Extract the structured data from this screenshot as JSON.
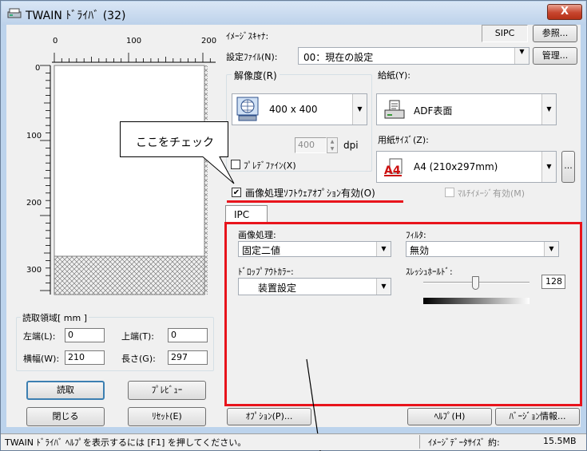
{
  "window": {
    "title": "TWAIN ﾄﾞﾗｲﾊﾞ (32)",
    "close_label": "X"
  },
  "ruler": {
    "top_ticks": [
      "0",
      "100",
      "200"
    ],
    "left_ticks": [
      "0",
      "100",
      "200",
      "300"
    ]
  },
  "scanner": {
    "label": "ｲﾒｰｼﾞｽｷｬﾅ:",
    "name": "SIPC",
    "browse": "参照..."
  },
  "settings_file": {
    "label": "設定ﾌｧｲﾙ(N):",
    "value": "00：現在の設定",
    "manage": "管理..."
  },
  "resolution": {
    "label": "解像度(R)",
    "value": "400 x 400",
    "spin_value": "400",
    "unit": "dpi",
    "preset_label": "ﾌﾟﾚﾃﾞﾌｧｲﾝ(X)"
  },
  "feed": {
    "label": "給紙(Y):",
    "value": "ADF表面"
  },
  "paper_size": {
    "label": "用紙ｻｲｽﾞ(Z):",
    "value": "A4 (210x297mm)",
    "icon_text": "A4",
    "more": "..."
  },
  "callout": {
    "text": "ここをチェック"
  },
  "ipc_option": {
    "label": "画像処理ｿﾌﾄｳｪｱｵﾌﾟｼｮﾝ有効(O)",
    "checked": true
  },
  "multi_image": {
    "label": "ﾏﾙﾁｲﾒｰｼﾞ有効(M)"
  },
  "ipc_tab": {
    "label": "IPC",
    "image_processing_label": "画像処理:",
    "image_processing_value": "固定二値",
    "filter_label": "ﾌｨﾙﾀ:",
    "filter_value": "無効",
    "dropout_label": "ﾄﾞﾛｯﾌﾟｱｳﾄｶﾗｰ:",
    "dropout_value": "装置設定",
    "threshold_label": "ｽﾚｯｼｭﾎｰﾙﾄﾞ:",
    "threshold_value": "128"
  },
  "read_area": {
    "label": "読取領域[ mm ]",
    "left_label": "左端(L):",
    "left_value": "0",
    "top_label": "上端(T):",
    "top_value": "0",
    "width_label": "横幅(W):",
    "width_value": "210",
    "length_label": "長さ(G):",
    "length_value": "297"
  },
  "buttons": {
    "scan": "読取",
    "preview": "ﾌﾟﾚﾋﾞｭｰ",
    "close": "閉じる",
    "reset": "ﾘｾｯﾄ(E)",
    "options": "ｵﾌﾟｼｮﾝ(P)...",
    "help": "ﾍﾙﾌﾟ(H)",
    "version": "ﾊﾞｰｼﾞｮﾝ情報..."
  },
  "status": {
    "help_text": "TWAIN ﾄﾞﾗｲﾊﾞ ﾍﾙﾌﾟを表示するには [F1] を押してください。",
    "data_size_label": "ｲﾒｰｼﾞﾃﾞｰﾀｻｲｽﾞ 約:",
    "data_size_value": "15.5MB"
  },
  "colors": {
    "highlight_red": "#e8141c",
    "window_frame": "#bcd3ec"
  }
}
